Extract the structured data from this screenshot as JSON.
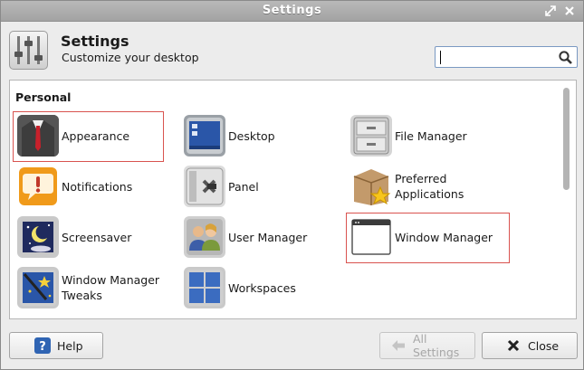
{
  "window": {
    "title": "Settings"
  },
  "header": {
    "title": "Settings",
    "subtitle": "Customize your desktop",
    "icon": "settings-sliders-icon"
  },
  "search": {
    "value": "",
    "placeholder": ""
  },
  "section": {
    "title": "Personal"
  },
  "items": [
    {
      "label_lines": [
        "Appearance"
      ],
      "icon": "appearance-icon",
      "highlighted": true
    },
    {
      "label_lines": [
        "Desktop"
      ],
      "icon": "desktop-icon",
      "highlighted": false
    },
    {
      "label_lines": [
        "File Manager"
      ],
      "icon": "file-manager-icon",
      "highlighted": false
    },
    {
      "label_lines": [
        "Notifications"
      ],
      "icon": "notifications-icon",
      "highlighted": false
    },
    {
      "label_lines": [
        "Panel"
      ],
      "icon": "panel-icon",
      "highlighted": false
    },
    {
      "label_lines": [
        "Preferred",
        "Applications"
      ],
      "icon": "preferred-applications-icon",
      "highlighted": false
    },
    {
      "label_lines": [
        "Screensaver"
      ],
      "icon": "screensaver-icon",
      "highlighted": false
    },
    {
      "label_lines": [
        "User Manager"
      ],
      "icon": "user-manager-icon",
      "highlighted": false
    },
    {
      "label_lines": [
        "Window Manager"
      ],
      "icon": "window-manager-icon",
      "highlighted": true
    },
    {
      "label_lines": [
        "Window Manager",
        "Tweaks"
      ],
      "icon": "window-manager-tweaks-icon",
      "highlighted": false
    },
    {
      "label_lines": [
        "Workspaces"
      ],
      "icon": "workspaces-icon",
      "highlighted": false
    }
  ],
  "footer": {
    "help_label": "Help",
    "all_settings_label": "All Settings",
    "close_label": "Close"
  },
  "colors": {
    "highlight": "#d9534f",
    "accent": "#3465a4"
  }
}
